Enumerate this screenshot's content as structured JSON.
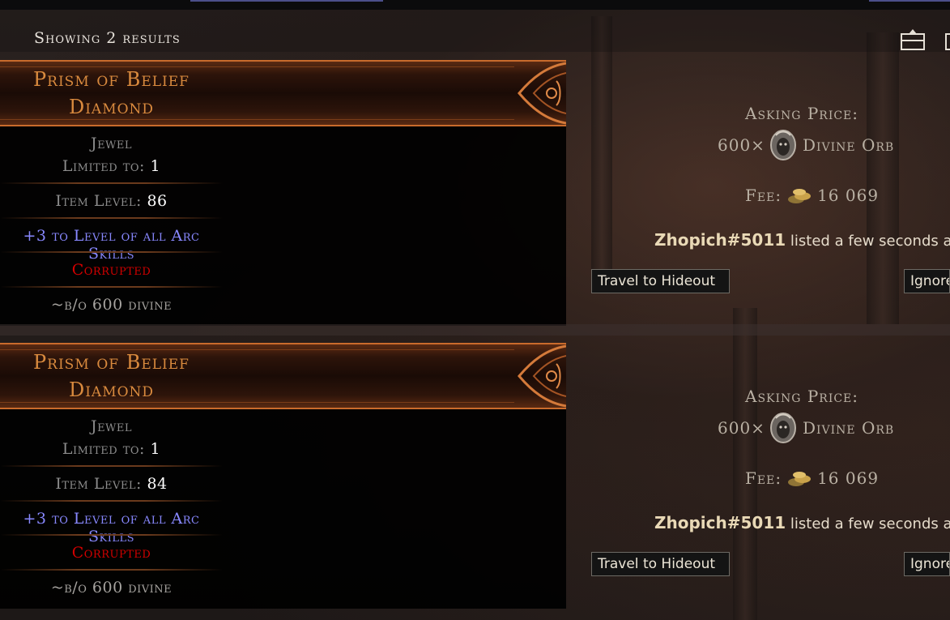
{
  "header": {
    "results_label": "Showing 2 results"
  },
  "icons": [
    "list-view-icon",
    "grid-view-icon",
    "divine-orb-icon",
    "gold-coin-icon",
    "item-frame-ornament-icon"
  ],
  "colors": {
    "unique_name": "#d98a3e",
    "magic_mod": "#8888ff",
    "corrupted": "#d20000",
    "property_value": "#ffffff",
    "property_label": "#8c8c8c",
    "header_border": "#c96b2c"
  },
  "listings": [
    {
      "item": {
        "name": "Prism of Belief",
        "base": "Diamond",
        "type": "Jewel",
        "limited_label": "Limited to: ",
        "limited_value": "1",
        "ilvl_label": "Item Level: ",
        "ilvl_value": "86",
        "mod": "+3 to Level of all Arc Skills",
        "corrupted": "Corrupted",
        "note": "~b/o 600 divine"
      },
      "price": {
        "asking_label": "Asking Price:",
        "amount": "600×",
        "currency": "Divine Orb",
        "fee_label": "Fee:",
        "fee_value": "16 069"
      },
      "seller": {
        "account": "Zhopich#5011",
        "listed": "listed a few seconds ago"
      },
      "actions": {
        "travel": "Travel to Hideout",
        "ignore": "Ignore"
      }
    },
    {
      "item": {
        "name": "Prism of Belief",
        "base": "Diamond",
        "type": "Jewel",
        "limited_label": "Limited to: ",
        "limited_value": "1",
        "ilvl_label": "Item Level: ",
        "ilvl_value": "84",
        "mod": "+3 to Level of all Arc Skills",
        "corrupted": "Corrupted",
        "note": "~b/o 600 divine"
      },
      "price": {
        "asking_label": "Asking Price:",
        "amount": "600×",
        "currency": "Divine Orb",
        "fee_label": "Fee:",
        "fee_value": "16 069"
      },
      "seller": {
        "account": "Zhopich#5011",
        "listed": "listed a few seconds ago"
      },
      "actions": {
        "travel": "Travel to Hideout",
        "ignore": "Ignore"
      }
    }
  ]
}
